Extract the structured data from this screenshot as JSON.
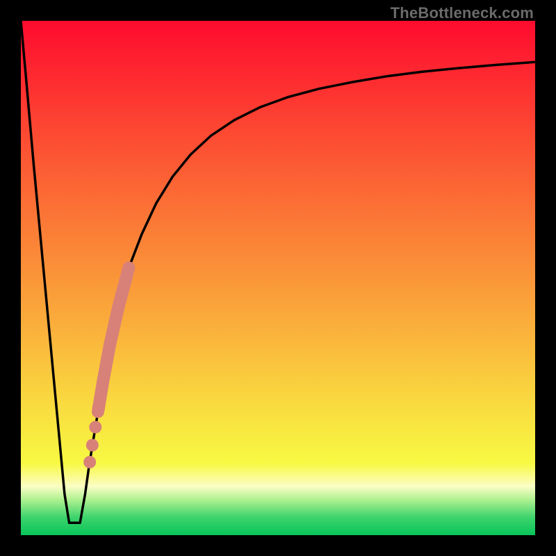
{
  "watermark": "TheBottleneck.com",
  "colors": {
    "frame": "#000000",
    "curve": "#000000",
    "dots": "#d88179",
    "gradient_stops": [
      {
        "offset": 0.0,
        "color": "#fe0b2e"
      },
      {
        "offset": 0.2,
        "color": "#fd4432"
      },
      {
        "offset": 0.4,
        "color": "#fb7b36"
      },
      {
        "offset": 0.58,
        "color": "#faab3b"
      },
      {
        "offset": 0.74,
        "color": "#f9d93f"
      },
      {
        "offset": 0.86,
        "color": "#f8f942"
      },
      {
        "offset": 0.905,
        "color": "#fbfdc5"
      },
      {
        "offset": 0.93,
        "color": "#b2f292"
      },
      {
        "offset": 0.965,
        "color": "#3ed36c"
      },
      {
        "offset": 1.0,
        "color": "#08c559"
      }
    ]
  },
  "chart_data": {
    "type": "line",
    "title": "",
    "xlabel": "",
    "ylabel": "",
    "xlim": [
      0,
      100
    ],
    "ylim": [
      0,
      100
    ],
    "series": [
      {
        "name": "bottleneck-curve",
        "x": [
          0,
          1,
          2.5,
          4,
          5.5,
          7,
          8.5,
          9.4,
          10.5,
          11.5,
          12.5,
          13.2,
          14,
          15,
          16,
          17.3,
          19,
          21,
          23.5,
          26.3,
          29.5,
          33,
          37,
          41.5,
          46.5,
          52,
          58,
          64.5,
          71,
          78,
          85,
          92,
          100
        ],
        "y": [
          100,
          89,
          72,
          56,
          40,
          24,
          8,
          2.4,
          2.4,
          2.4,
          8,
          13,
          18,
          24,
          30,
          37,
          44.5,
          52,
          58.5,
          64.5,
          69.7,
          74,
          77.7,
          80.7,
          83.2,
          85.2,
          86.8,
          88.1,
          89.2,
          90.1,
          90.8,
          91.4,
          92
        ]
      }
    ],
    "highlight_segment": {
      "name": "highlight-band",
      "start_index": 13,
      "end_index": 17,
      "x": [
        15,
        16,
        17.3,
        19,
        21
      ],
      "y": [
        24,
        30,
        37,
        44.5,
        52
      ]
    },
    "highlight_dots": {
      "name": "highlight-dots",
      "points": [
        {
          "x": 13.4,
          "y": 14.2
        },
        {
          "x": 13.9,
          "y": 17.5
        },
        {
          "x": 14.5,
          "y": 21.0
        },
        {
          "x": 15.1,
          "y": 24.8
        }
      ]
    }
  }
}
